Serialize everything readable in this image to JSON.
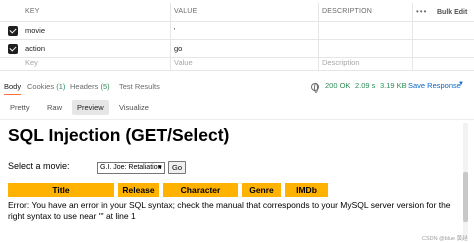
{
  "params": {
    "headers": {
      "key": "KEY",
      "value": "VALUE",
      "description": "DESCRIPTION",
      "more": "•••",
      "bulk_edit": "Bulk Edit"
    },
    "rows": [
      {
        "checked": true,
        "key": "movie",
        "value": "'",
        "description": ""
      },
      {
        "checked": true,
        "key": "action",
        "value": "go",
        "description": ""
      }
    ],
    "new_row": {
      "key_placeholder": "Key",
      "value_placeholder": "Value",
      "description_placeholder": "Description"
    }
  },
  "response": {
    "tabs": [
      {
        "label": "Body",
        "count": ""
      },
      {
        "label": "Cookies",
        "count": "(1)"
      },
      {
        "label": "Headers",
        "count": "(5)"
      },
      {
        "label": "Test Results",
        "count": ""
      }
    ],
    "status": "200 OK",
    "time": "2.09 s",
    "size": "3.19 KB",
    "save_label": "Save Response",
    "view_modes": [
      "Pretty",
      "Raw",
      "Preview",
      "Visualize"
    ]
  },
  "preview": {
    "title": "SQL Injection (GET/Select)",
    "select_label": "Select a movie:",
    "select_value": "G.I. Joe: Retaliation",
    "go_label": "Go",
    "columns": [
      "Title",
      "Release",
      "Character",
      "Genre",
      "IMDb"
    ],
    "error": "Error: You have an error in your SQL syntax; check the manual that corresponds to your MySQL server version for the right syntax to use near ''' at line 1"
  },
  "watermark": "CSDN @blue 黄越",
  "colors": {
    "accent": "#ff6c37",
    "status": "#2e8b57",
    "link": "#0a66c2",
    "table_header": "#ffb300"
  }
}
